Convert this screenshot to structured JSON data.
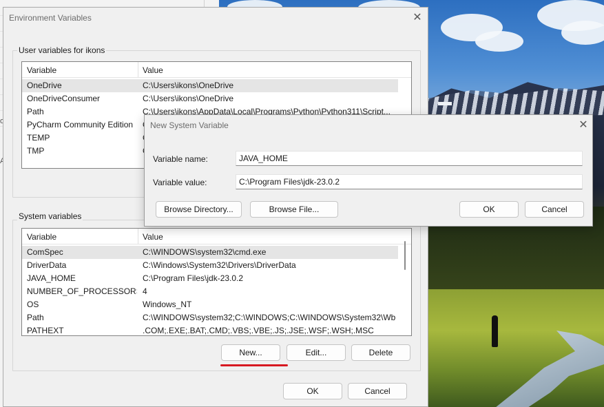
{
  "env_dialog": {
    "title": "Environment Variables",
    "user_group_label": "User variables for ikons",
    "user_columns": [
      "Variable",
      "Value"
    ],
    "user_rows": [
      {
        "variable": "OneDrive",
        "value": "C:\\Users\\ikons\\OneDrive"
      },
      {
        "variable": "OneDriveConsumer",
        "value": "C:\\Users\\ikons\\OneDrive"
      },
      {
        "variable": "Path",
        "value": "C:\\Users\\ikons\\AppData\\Local\\Programs\\Python\\Python311\\Script..."
      },
      {
        "variable": "PyCharm Community Edition",
        "value": "C"
      },
      {
        "variable": "TEMP",
        "value": "C"
      },
      {
        "variable": "TMP",
        "value": "C"
      }
    ],
    "system_group_label": "System variables",
    "system_columns": [
      "Variable",
      "Value"
    ],
    "system_rows": [
      {
        "variable": "ComSpec",
        "value": "C:\\WINDOWS\\system32\\cmd.exe"
      },
      {
        "variable": "DriverData",
        "value": "C:\\Windows\\System32\\Drivers\\DriverData"
      },
      {
        "variable": "JAVA_HOME",
        "value": "C:\\Program Files\\jdk-23.0.2"
      },
      {
        "variable": "NUMBER_OF_PROCESSORS",
        "value": "4"
      },
      {
        "variable": "OS",
        "value": "Windows_NT"
      },
      {
        "variable": "Path",
        "value": "C:\\WINDOWS\\system32;C:\\WINDOWS;C:\\WINDOWS\\System32\\Wb..."
      },
      {
        "variable": "PATHEXT",
        "value": ".COM;.EXE;.BAT;.CMD;.VBS;.VBE;.JS;.JSE;.WSF;.WSH;.MSC"
      }
    ],
    "new_label": "New...",
    "edit_label": "Edit...",
    "delete_label": "Delete",
    "ok_label": "OK",
    "cancel_label": "Cancel",
    "close_glyph": "✕"
  },
  "new_var_dialog": {
    "title": "New System Variable",
    "name_label": "Variable name:",
    "name_value": "JAVA_HOME",
    "value_label": "Variable value:",
    "value_value": "C:\\Program Files\\jdk-23.0.2",
    "browse_dir_label": "Browse Directory...",
    "browse_file_label": "Browse File...",
    "ok_label": "OK",
    "cancel_label": "Cancel",
    "close_glyph": "✕"
  },
  "background_window": {
    "glyphs": [
      "ol",
      "A"
    ]
  },
  "colors": {
    "dialog_bg": "#f0f0f0",
    "selected_row": "#e5e5e5",
    "annotation_underline": "#d71921"
  }
}
